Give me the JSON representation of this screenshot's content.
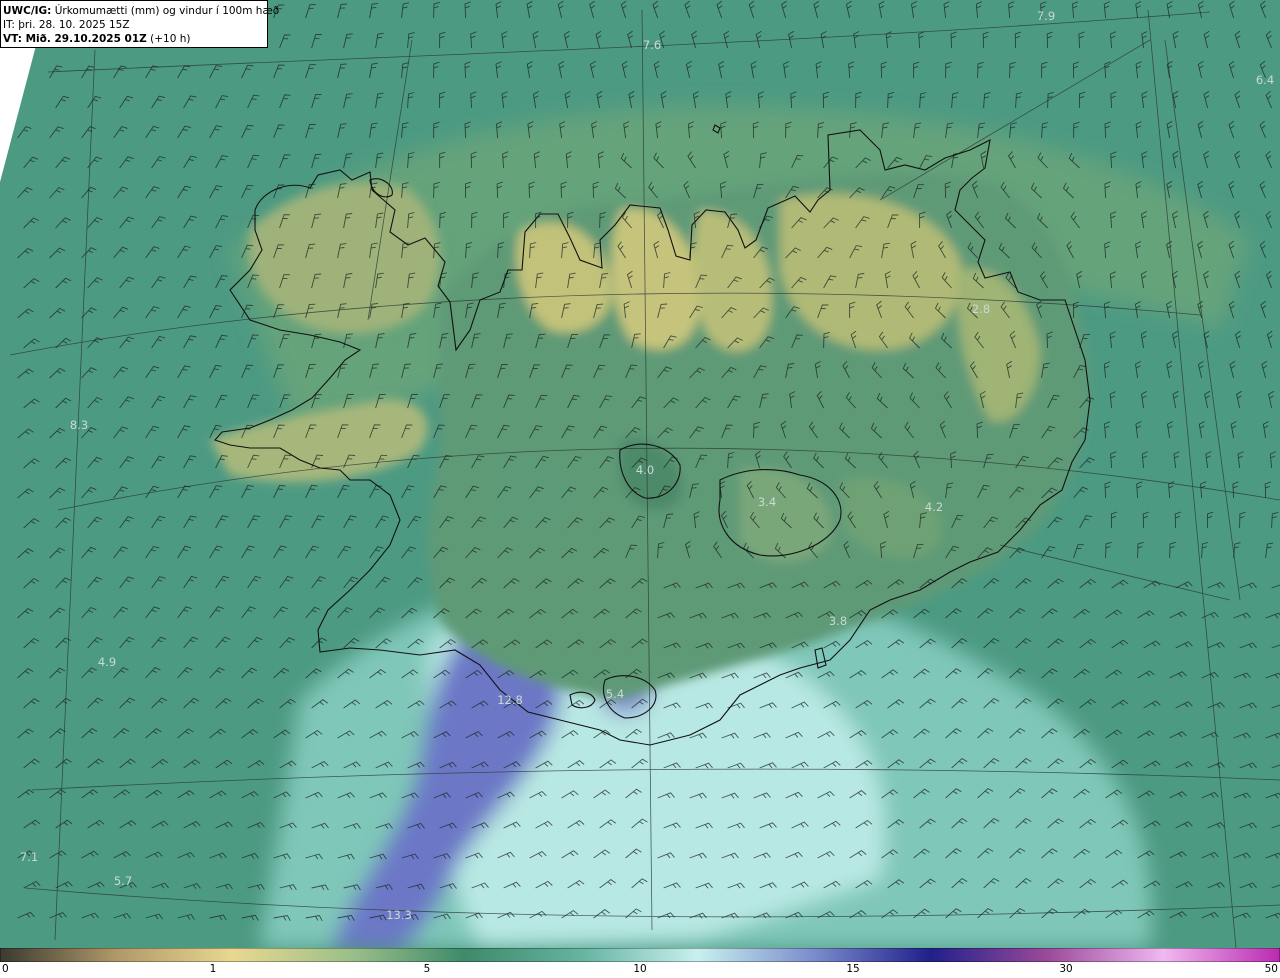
{
  "header": {
    "product": "UWC/IG:",
    "title": "Úrkomumætti (mm) og vindur í 100m hæð",
    "it_label": "IT:",
    "it_value": "þri. 28. 10. 2025 15Z",
    "vt_label": "VT: Mið. 29.10.2025 01Z",
    "vt_lead": "(+10 h)"
  },
  "map_values": [
    {
      "text": "7.9"
    },
    {
      "text": "7.6"
    },
    {
      "text": "6.4"
    },
    {
      "text": "2.8"
    },
    {
      "text": "8.3"
    },
    {
      "text": "4.0"
    },
    {
      "text": "3.4"
    },
    {
      "text": "4.2"
    },
    {
      "text": "3.8"
    },
    {
      "text": "4.9"
    },
    {
      "text": "5.4"
    },
    {
      "text": "12.8"
    },
    {
      "text": "7.1"
    },
    {
      "text": "5.7"
    },
    {
      "text": "13.3"
    }
  ],
  "colorbar": {
    "ticks": [
      {
        "value": "0"
      },
      {
        "value": "1"
      },
      {
        "value": "5"
      },
      {
        "value": "10"
      },
      {
        "value": "15"
      },
      {
        "value": "30"
      },
      {
        "value": "50"
      }
    ],
    "colors": [
      "#3a3a30",
      "#b09868",
      "#e8d890",
      "#9cc08a",
      "#3e8a6a",
      "#66b4a2",
      "#c8f0ee",
      "#7a8ccc",
      "#20208a",
      "#9a4a9a",
      "#f0b8f0",
      "#b82ab0"
    ]
  },
  "colors": {
    "ocean": "#4d9a83",
    "land_high": "#b8bd74",
    "land_mid": "#74a277",
    "heavy_precip": "#6c78c6",
    "light_blue": "#c2eee9",
    "coast": "#111111",
    "grid": "#2b3a36",
    "barb": "#1a2622"
  }
}
